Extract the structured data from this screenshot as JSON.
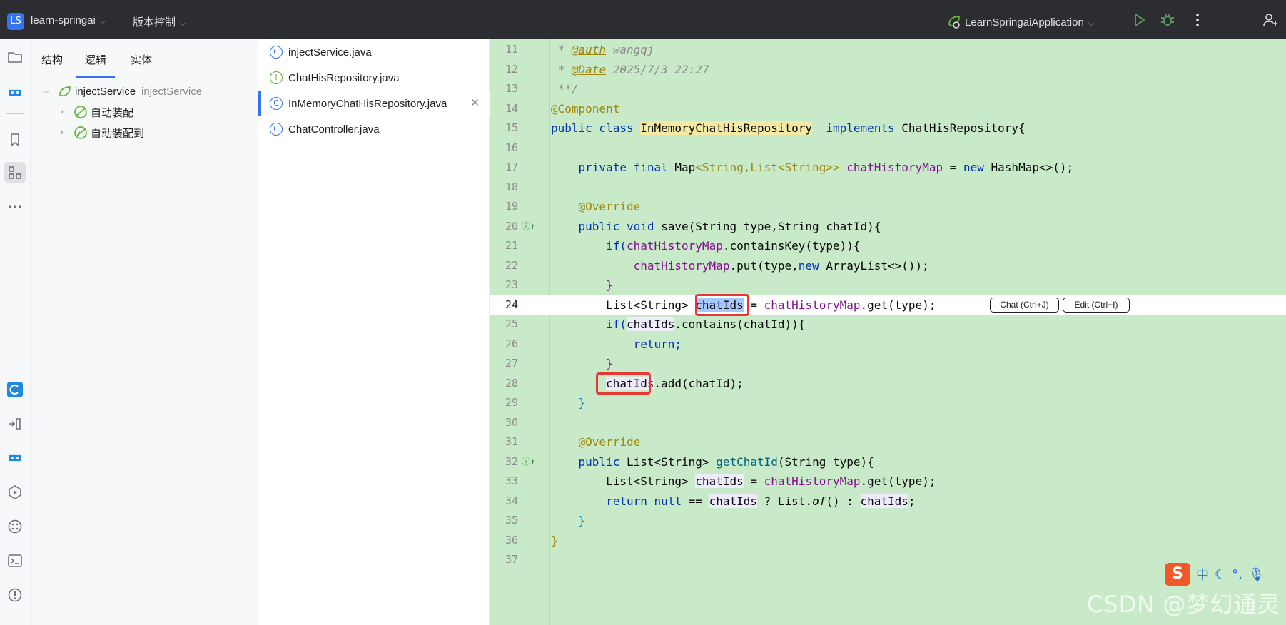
{
  "titlebar": {
    "project_badge": "LS",
    "project_name": "learn-springai",
    "vcs": "版本控制",
    "run_config": "LearnSpringaiApplication"
  },
  "structure_panel": {
    "tabs": [
      "结构",
      "逻辑",
      "实体"
    ],
    "active_tab": "逻辑",
    "tree": {
      "root_label": "injectService",
      "root_secondary": "injectService",
      "children": [
        "自动装配",
        "自动装配到"
      ]
    }
  },
  "files": [
    {
      "name": "injectService.java",
      "kind": "class"
    },
    {
      "name": "ChatHisRepository.java",
      "kind": "interface"
    },
    {
      "name": "InMemoryChatHisRepository.java",
      "kind": "class",
      "selected": true
    },
    {
      "name": "ChatController.java",
      "kind": "class"
    }
  ],
  "editor": {
    "current_line": 24,
    "lines": {
      "l11_a": " * ",
      "l11_tag": "@auth",
      "l11_b": " wangqj",
      "l12_a": " * ",
      "l12_tag": "@Date",
      "l12_b": " 2025/7/3 22:27",
      "l13": " **/",
      "l14": "@Component",
      "l15_kw": "public class ",
      "l15_cls": "InMemoryChatHisRepository",
      "l15_kw2": "  implements ",
      "l15_rest": "ChatHisRepository{",
      "l17_kw": "    private final ",
      "l17_type": "Map",
      "l17_gen": "<String,List<String>>",
      "l17_fld": " chatHistoryMap",
      "l17_eq": " = ",
      "l17_new": "new ",
      "l17_rest": "HashMap<>();",
      "l19": "    @Override",
      "l20_kw": "    public void ",
      "l20_rest": "save(String type,String chatId){",
      "l21_kw": "        if(",
      "l21_fld": "chatHistoryMap",
      "l21_rest": ".containsKey(type)){",
      "l22_fld": "            chatHistoryMap",
      "l22_rest": ".put(type,",
      "l22_new": "new ",
      "l22_rest2": "ArrayList<>());",
      "l23": "        }",
      "l24_a": "        List<String> ",
      "l24_var": "chatIds",
      "l24_b": " = ",
      "l24_fld": "chatHistoryMap",
      "l24_c": ".get(type);",
      "l25_kw": "        if(",
      "l25_var": "chatIds",
      "l25_rest": ".contains(chatId)){",
      "l26": "            return;",
      "l27": "        }",
      "l28_a": "        ",
      "l28_var": "chatIds",
      "l28_b": ".add(chatId);",
      "l29": "    }",
      "l31": "    @Override",
      "l32_kw": "    public ",
      "l32_type": "List<String> ",
      "l32_m": "getChatId",
      "l32_rest": "(String type){",
      "l33_a": "        List<String> ",
      "l33_var": "chatIds",
      "l33_b": " = ",
      "l33_fld": "chatHistoryMap",
      "l33_c": ".get(type);",
      "l34_kw": "        return null",
      "l34_a": " == ",
      "l34_var": "chatIds",
      "l34_b": " ? List.",
      "l34_of": "of",
      "l34_c": "() : ",
      "l34_var2": "chatIds",
      "l34_d": ";",
      "l35": "    }",
      "l36": "}"
    },
    "ai_buttons": [
      "Chat (Ctrl+J)",
      "Edit (Ctrl+I)"
    ]
  },
  "ime": {
    "logo": "S",
    "mode": "中"
  },
  "watermark": "CSDN @梦幻通灵"
}
